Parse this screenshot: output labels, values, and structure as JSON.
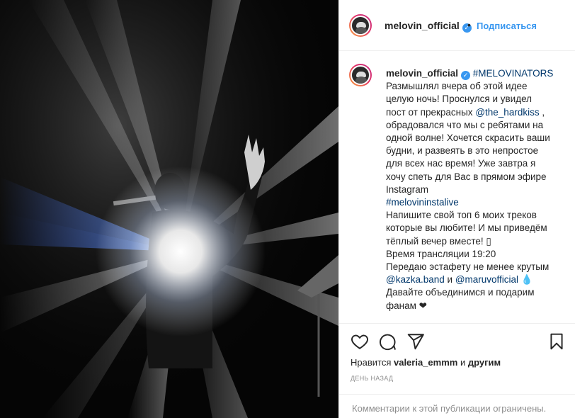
{
  "photo": {
    "alt_icon": "concert-photo"
  },
  "header": {
    "username": "melovin_official",
    "verified_icon": "verified-badge-icon",
    "separator": "•",
    "follow_label": "Подписаться"
  },
  "caption": {
    "username": "melovin_official",
    "hashtag": "#MELOVINATORS",
    "lines": [
      "Размышлял вчера об этой идее",
      "целую ночь! Проснулся и увидел",
      "пост от прекрасных"
    ],
    "mention_hardkiss": "@the_hardkiss",
    "after_hardkiss": " ,",
    "lines2": [
      "обрадовался что мы с ребятами на",
      "одной волне! Хочется скрасить ваши",
      "будни, и развеять в это непростое",
      "для всех нас время! Уже завтра я",
      "хочу спеть для Вас в прямом эфире",
      "Instagram"
    ],
    "hashtag2": "#melovininstalive",
    "lines3": [
      "Напишите свой топ 6 моих треков",
      "которые вы любите! И мы приведём",
      "тёплый вечер вместе! ▯",
      "Время трансляции 19:20",
      "Передаю эстафету не менее крутым"
    ],
    "mention_kazka": "@kazka.band",
    "and_word": " и ",
    "mention_maruv": "@maruvofficial",
    "drop_glyph": " 💧",
    "line_last1": "Давайте объединимся и подарим",
    "line_last2": "фанам",
    "heart_glyph": " ❤"
  },
  "actions": {
    "like_icon": "heart-icon",
    "comment_icon": "comment-icon",
    "share_icon": "share-icon",
    "save_icon": "bookmark-icon",
    "likes_prefix": "Нравится ",
    "likes_user": "valeria_emmm",
    "likes_and": " и ",
    "likes_others": "другим",
    "time_ago": "ДЕНЬ НАЗАД"
  },
  "footer": {
    "comments_disabled": "Комментарии к этой публикации ограничены."
  }
}
